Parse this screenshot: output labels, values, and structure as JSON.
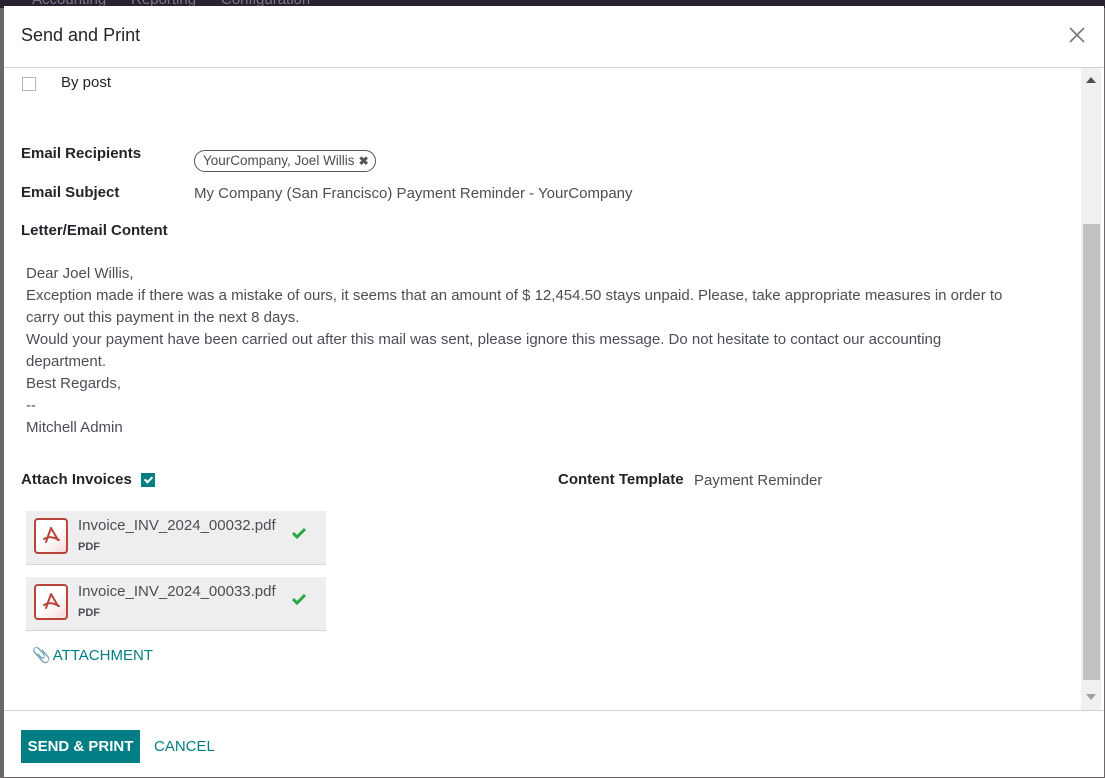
{
  "background_app": {
    "menu": [
      "Accounting",
      "Reporting",
      "Configuration"
    ]
  },
  "dialog": {
    "title": "Send and Print",
    "close_icon": "close-icon"
  },
  "options": {
    "by_post": {
      "label": "By post",
      "checked": false
    }
  },
  "form": {
    "recipients_label": "Email Recipients",
    "recipients": [
      {
        "name": "YourCompany, Joel Willis",
        "remove_icon": "x-icon"
      }
    ],
    "subject_label": "Email Subject",
    "subject_value": "My Company (San Francisco) Payment Reminder - YourCompany",
    "content_label": "Letter/Email Content",
    "content_lines": [
      "Dear Joel Willis,",
      "Exception made if there was a mistake of ours, it seems that an amount of $ 12,454.50 stays unpaid. Please, take appropriate measures in order to carry out this payment in the next 8 days.",
      "Would your payment have been carried out after this mail was sent, please ignore this message. Do not hesitate to contact our accounting department.",
      "Best Regards,",
      "--",
      "Mitchell Admin"
    ],
    "attach_invoices_label": "Attach Invoices",
    "attach_invoices_checked": true,
    "content_template_label": "Content Template",
    "content_template_value": "Payment Reminder"
  },
  "attachments": [
    {
      "name": "Invoice_INV_2024_00032.pdf",
      "type": "PDF",
      "icon": "pdf-icon",
      "status_icon": "check-icon"
    },
    {
      "name": "Invoice_INV_2024_00033.pdf",
      "type": "PDF",
      "icon": "pdf-icon",
      "status_icon": "check-icon"
    }
  ],
  "add_attachment_label": "ATTACHMENT",
  "footer": {
    "primary_label": "SEND & PRINT",
    "cancel_label": "CANCEL"
  },
  "colors": {
    "accent": "#017e84",
    "pdf_red": "#b9443b",
    "check_green": "#28a745"
  }
}
